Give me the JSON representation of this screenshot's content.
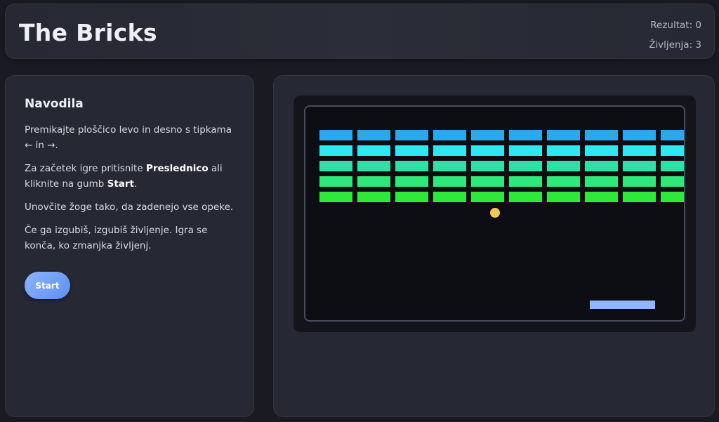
{
  "header": {
    "title": "The Bricks",
    "score": "Rezultat: 0",
    "lives": "Življenja: 3"
  },
  "instructions": {
    "heading": "Navodila",
    "p1": "Premikajte ploščico levo in desno s tipkama ← in →.",
    "p2_pre": "Za začetek igre pritisnite ",
    "p2_key": "Preslednico",
    "p2_mid": " ali kliknite na gumb ",
    "p2_btn": "Start",
    "p2_end": ".",
    "p3": "Unovčite žoge tako, da zadenejo vse opeke.",
    "p4": "Če ga izgubiš, izgubiš življenje. Igra se konča, ko zmanjka življenj.",
    "start_label": "Start"
  },
  "game": {
    "brick_rows": 5,
    "brick_cols": 10,
    "row_colors": [
      "#2ea6ea",
      "#2de8f0",
      "#2ee0a6",
      "#2ee879",
      "#2ee83a"
    ],
    "ball_color": "#f5c75a",
    "paddle_color": "#8fb6ff"
  }
}
